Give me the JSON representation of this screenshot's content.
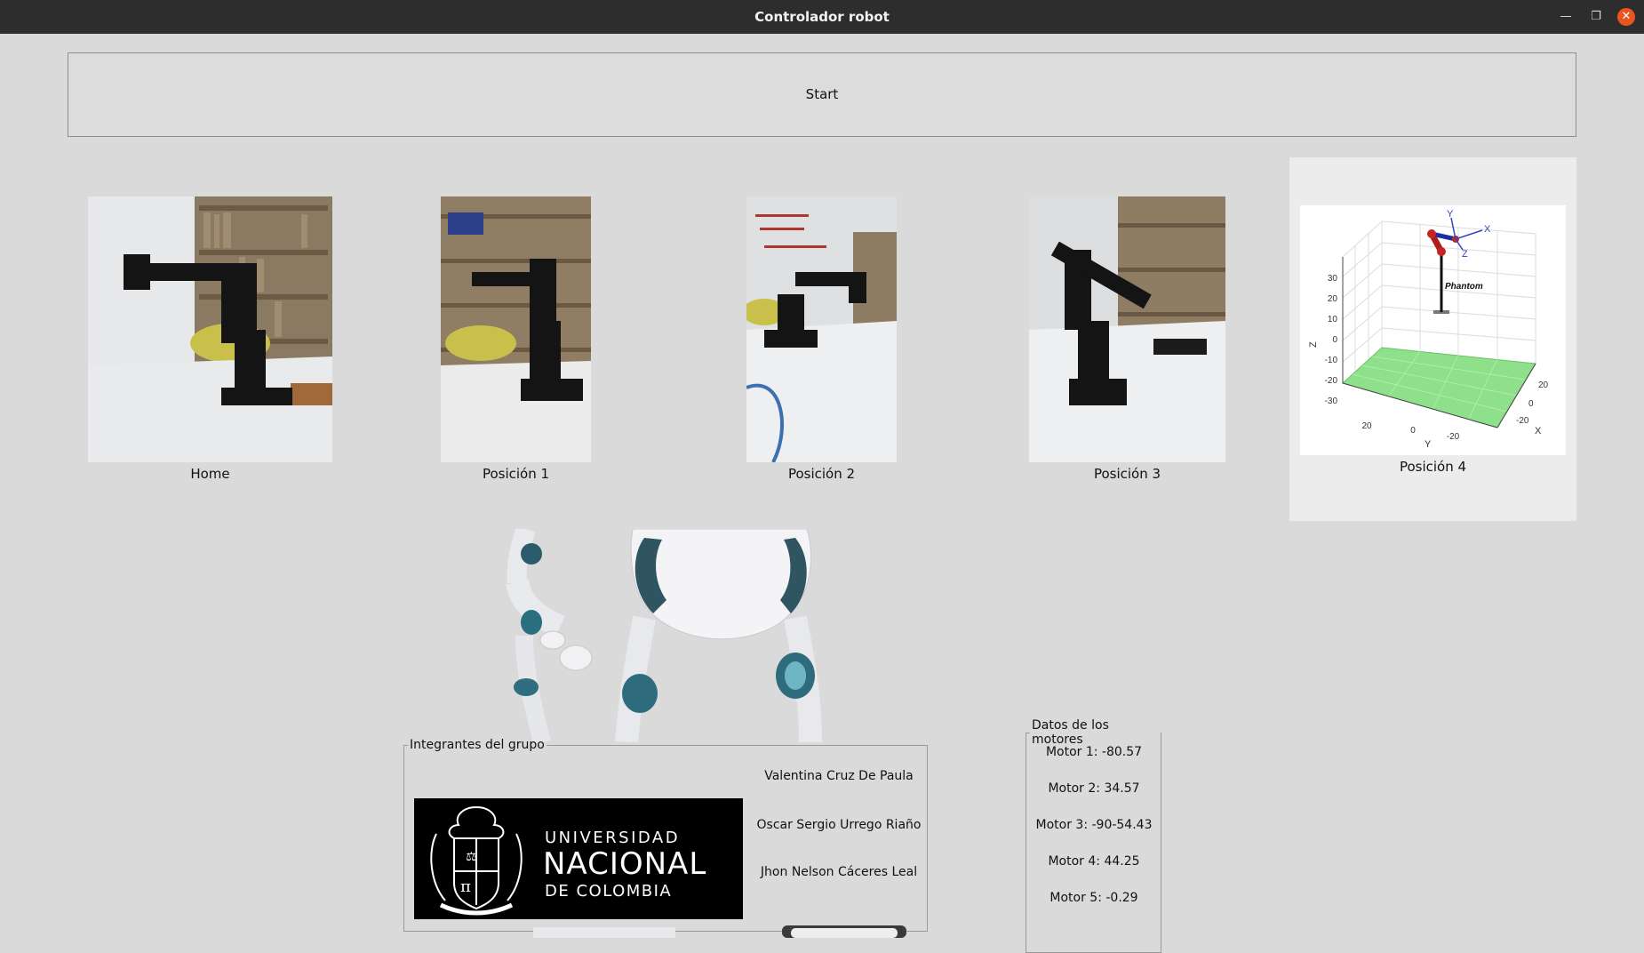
{
  "window": {
    "title": "Controlador robot"
  },
  "start_button": {
    "label": "Start"
  },
  "positions": [
    {
      "label": "Home"
    },
    {
      "label": "Posición 1"
    },
    {
      "label": "Posición 2"
    },
    {
      "label": "Posición 3"
    },
    {
      "label": "Posición 4"
    }
  ],
  "plot": {
    "annotation": "Phantom",
    "z_ticks": [
      "30",
      "20",
      "10",
      "0",
      "-10",
      "-20",
      "-30"
    ],
    "y_ticks": [
      "20",
      "0",
      "-20"
    ],
    "x_ticks": [
      "20",
      "0",
      "-20"
    ],
    "z_label": "Z",
    "y_label": "Y",
    "x_label": "X",
    "frame_labels": [
      "X",
      "Y",
      "Z"
    ]
  },
  "group": {
    "legend": "Integrantes del grupo",
    "logo": {
      "line1": "UNIVERSIDAD",
      "line2": "NACIONAL",
      "line3": "DE COLOMBIA"
    },
    "members": [
      "Valentina Cruz De Paula",
      "Oscar Sergio Urrego Riaño",
      "Jhon Nelson Cáceres Leal"
    ]
  },
  "motors": {
    "legend": "Datos de los motores",
    "items": [
      "Motor 1: -80.57",
      "Motor 2: 34.57",
      "Motor 3: -90-54.43",
      "Motor 4: 44.25",
      "Motor 5: -0.29"
    ]
  }
}
